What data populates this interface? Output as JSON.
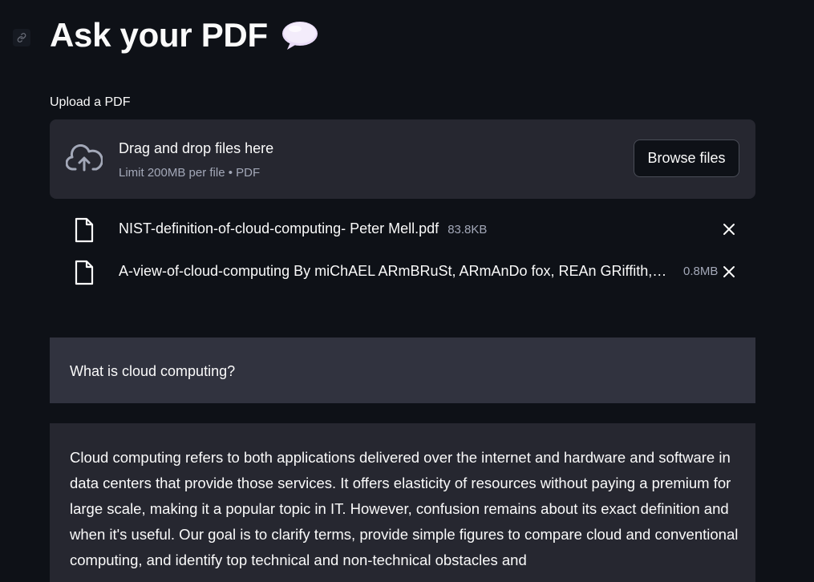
{
  "page": {
    "title": "Ask your PDF",
    "title_emoji": "speech-balloon-icon"
  },
  "uploader": {
    "label": "Upload a PDF",
    "instructions": "Drag and drop files here",
    "limit": "Limit 200MB per file • PDF",
    "browse_label": "Browse files"
  },
  "files": [
    {
      "name": "NIST-definition-of-cloud-computing- Peter Mell.pdf",
      "size": "83.8KB"
    },
    {
      "name": "A-view-of-cloud-computing By miChAEL ARmBRuSt, ARmAnDo fox, REAn GRiffith,…",
      "size": "0.8MB"
    }
  ],
  "chat": {
    "question": "What is cloud computing?",
    "answer": "Cloud computing refers to both applications delivered over the internet and hardware and software in data centers that provide those services. It offers elasticity of resources without paying a premium for large scale, making it a popular topic in IT. However, confusion remains about its exact definition and when it's useful. Our goal is to clarify terms, provide simple figures to compare cloud and conventional computing, and identify top technical and non-technical obstacles and"
  },
  "colors": {
    "background": "#0e1117",
    "panel": "#262730",
    "question_panel": "#31333f",
    "text": "#fafafa",
    "muted_text": "#a3a8b8"
  }
}
